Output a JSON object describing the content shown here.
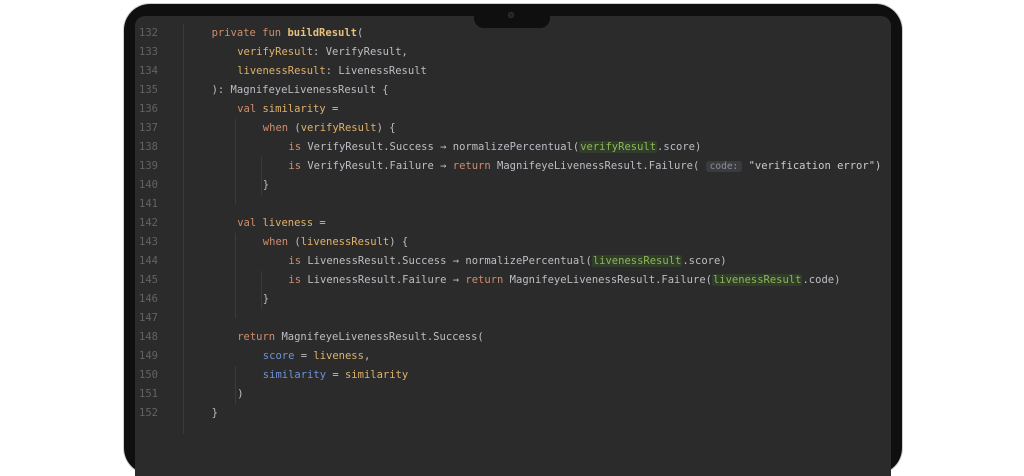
{
  "lines": [
    {
      "n": "132",
      "parts": [
        {
          "t": "private fun ",
          "c": "kw"
        },
        {
          "t": "buildResult",
          "c": "fn"
        },
        {
          "t": "(",
          "c": ""
        }
      ],
      "indent": 1
    },
    {
      "n": "133",
      "parts": [
        {
          "t": "verifyResult",
          "c": "param"
        },
        {
          "t": ": VerifyResult,",
          "c": ""
        }
      ],
      "indent": 2
    },
    {
      "n": "134",
      "parts": [
        {
          "t": "livenessResult",
          "c": "param"
        },
        {
          "t": ": LivenessResult",
          "c": ""
        }
      ],
      "indent": 2
    },
    {
      "n": "135",
      "parts": [
        {
          "t": "): MagnifeyeLivenessResult {",
          "c": ""
        }
      ],
      "indent": 1
    },
    {
      "n": "136",
      "parts": [
        {
          "t": "val ",
          "c": "kw"
        },
        {
          "t": "similarity",
          "c": "param"
        },
        {
          "t": " =",
          "c": ""
        }
      ],
      "indent": 2
    },
    {
      "n": "137",
      "parts": [
        {
          "t": "when ",
          "c": "kw"
        },
        {
          "t": "(",
          "c": ""
        },
        {
          "t": "verifyResult",
          "c": "param"
        },
        {
          "t": ") {",
          "c": ""
        }
      ],
      "indent": 3
    },
    {
      "n": "138",
      "parts": [
        {
          "t": "is ",
          "c": "kw"
        },
        {
          "t": "VerifyResult.Success → normalizePercentual(",
          "c": ""
        },
        {
          "t": "verifyResult",
          "c": "hl"
        },
        {
          "t": ".score)",
          "c": ""
        }
      ],
      "indent": 4
    },
    {
      "n": "139",
      "parts": [
        {
          "t": "is ",
          "c": "kw"
        },
        {
          "t": "VerifyResult.Failure → ",
          "c": ""
        },
        {
          "t": "return ",
          "c": "kw"
        },
        {
          "t": "MagnifeyeLivenessResult.Failure( ",
          "c": ""
        },
        {
          "t": "code:",
          "c": "hint"
        },
        {
          "t": " \"verification error\")",
          "c": "str"
        }
      ],
      "indent": 4
    },
    {
      "n": "140",
      "parts": [
        {
          "t": "}",
          "c": ""
        }
      ],
      "indent": 3
    },
    {
      "n": "141",
      "parts": [],
      "indent": 0
    },
    {
      "n": "142",
      "parts": [
        {
          "t": "val ",
          "c": "kw"
        },
        {
          "t": "liveness",
          "c": "param"
        },
        {
          "t": " =",
          "c": ""
        }
      ],
      "indent": 2
    },
    {
      "n": "143",
      "parts": [
        {
          "t": "when ",
          "c": "kw"
        },
        {
          "t": "(",
          "c": ""
        },
        {
          "t": "livenessResult",
          "c": "param"
        },
        {
          "t": ") {",
          "c": ""
        }
      ],
      "indent": 3
    },
    {
      "n": "144",
      "parts": [
        {
          "t": "is ",
          "c": "kw"
        },
        {
          "t": "LivenessResult.Success → normalizePercentual(",
          "c": ""
        },
        {
          "t": "livenessResult",
          "c": "hl"
        },
        {
          "t": ".score)",
          "c": ""
        }
      ],
      "indent": 4
    },
    {
      "n": "145",
      "parts": [
        {
          "t": "is ",
          "c": "kw"
        },
        {
          "t": "LivenessResult.Failure → ",
          "c": ""
        },
        {
          "t": "return ",
          "c": "kw"
        },
        {
          "t": "MagnifeyeLivenessResult.Failure(",
          "c": ""
        },
        {
          "t": "livenessResult",
          "c": "hl"
        },
        {
          "t": ".code)",
          "c": ""
        }
      ],
      "indent": 4
    },
    {
      "n": "146",
      "parts": [
        {
          "t": "}",
          "c": ""
        }
      ],
      "indent": 3
    },
    {
      "n": "147",
      "parts": [],
      "indent": 0
    },
    {
      "n": "148",
      "parts": [
        {
          "t": "return ",
          "c": "kw"
        },
        {
          "t": "MagnifeyeLivenessResult.Success(",
          "c": ""
        }
      ],
      "indent": 2
    },
    {
      "n": "149",
      "parts": [
        {
          "t": "score",
          "c": "prop"
        },
        {
          "t": " = ",
          "c": ""
        },
        {
          "t": "liveness",
          "c": "param"
        },
        {
          "t": ",",
          "c": ""
        }
      ],
      "indent": 3
    },
    {
      "n": "150",
      "parts": [
        {
          "t": "similarity",
          "c": "prop"
        },
        {
          "t": " = ",
          "c": ""
        },
        {
          "t": "similarity",
          "c": "param"
        }
      ],
      "indent": 3
    },
    {
      "n": "151",
      "parts": [
        {
          "t": ")",
          "c": ""
        }
      ],
      "indent": 2
    },
    {
      "n": "152",
      "parts": [
        {
          "t": "}",
          "c": ""
        }
      ],
      "indent": 1
    }
  ]
}
